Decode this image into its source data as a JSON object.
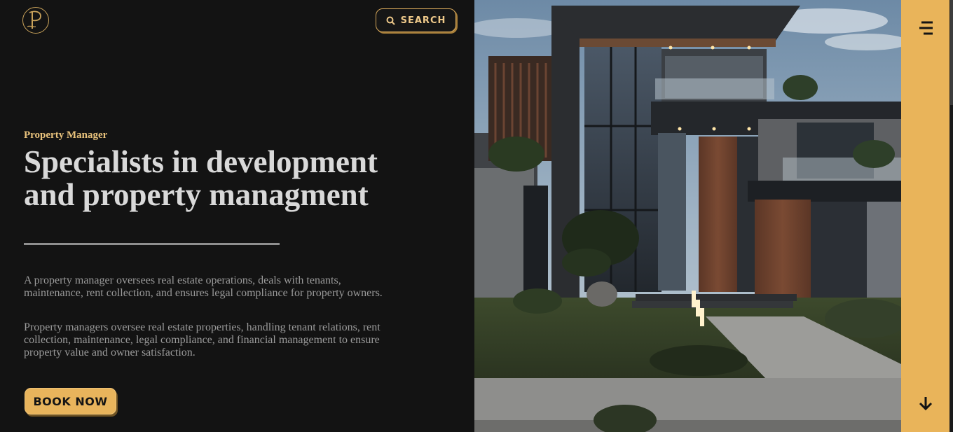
{
  "brand": {
    "logo_letter": "P",
    "logo_icon": "monogram-logo",
    "accent_color": "#e9b45a",
    "background_color": "#131313"
  },
  "header": {
    "search_label": "SEARCH",
    "search_icon": "search-icon"
  },
  "hero": {
    "eyebrow": "Property Manager",
    "headline_line1": "Specialists in development",
    "headline_line2": "and property managment",
    "paragraph1": "A property manager oversees real estate operations, deals with tenants, maintenance, rent collection, and ensures legal compliance for property owners.",
    "paragraph2": "Property managers oversee real estate properties, handling tenant relations, rent collection, maintenance, legal compliance, and financial management to ensure property value and owner satisfaction.",
    "cta_label": "BOOK NOW"
  },
  "image": {
    "subject": "modern-house-photo"
  },
  "rail": {
    "menu_icon": "menu-icon",
    "scroll_icon": "arrow-down-icon"
  }
}
